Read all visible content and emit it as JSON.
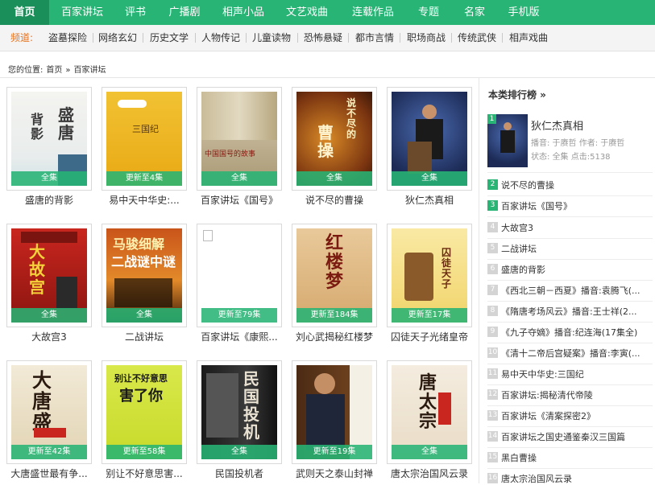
{
  "nav": {
    "items": [
      "首页",
      "百家讲坛",
      "评书",
      "广播剧",
      "相声小品",
      "文艺戏曲",
      "连载作品",
      "专题",
      "名家",
      "手机版"
    ],
    "active": 0
  },
  "channels": {
    "label": "频道:",
    "items": [
      "盗墓探险",
      "网络玄幻",
      "历史文学",
      "人物传记",
      "儿童读物",
      "恐怖悬疑",
      "都市言情",
      "职场商战",
      "传统武侠",
      "相声戏曲"
    ]
  },
  "breadcrumb": {
    "label": "您的位置:",
    "home": "首页",
    "sep": "»",
    "current": "百家讲坛"
  },
  "colors": {
    "accent": "#27b474",
    "channel_label": "#e6731f"
  },
  "books": [
    {
      "title": "盛唐的背影",
      "status": "全集",
      "cover": "c0",
      "cover_text": "盛唐 背影"
    },
    {
      "title": "易中天中华史:...",
      "status": "更新至4集",
      "cover": "c1",
      "cover_text": "三国纪"
    },
    {
      "title": "百家讲坛《国号》",
      "status": "全集",
      "cover": "c2",
      "cover_text": "中国国号的故事"
    },
    {
      "title": "说不尽的曹操",
      "status": "全集",
      "cover": "c3",
      "cover_text": "曹操"
    },
    {
      "title": "狄仁杰真相",
      "status": "全集",
      "cover": "c4",
      "cover_text": ""
    },
    {
      "title": "大故宫3",
      "status": "全集",
      "cover": "c5",
      "cover_text": "大故宫"
    },
    {
      "title": "二战讲坛",
      "status": "全集",
      "cover": "c6",
      "cover_text": "马骏细解 二战谜中谜"
    },
    {
      "title": "百家讲坛《康熙...",
      "status": "更新至79集",
      "cover": "c7",
      "cover_text": ""
    },
    {
      "title": "刘心武揭秘红楼梦",
      "status": "更新至184集",
      "cover": "c8",
      "cover_text": "红楼梦"
    },
    {
      "title": "囚徒天子光绪皇帝",
      "status": "更新至17集",
      "cover": "c9",
      "cover_text": "囚徒天子"
    },
    {
      "title": "大唐盛世最有争...",
      "status": "更新至42集",
      "cover": "c10",
      "cover_text": "大唐盛"
    },
    {
      "title": "别让不好意思害...",
      "status": "更新至58集",
      "cover": "c11",
      "cover_text": "别让不好意思 害了你"
    },
    {
      "title": "民国投机者",
      "status": "全集",
      "cover": "c12",
      "cover_text": "民国投机"
    },
    {
      "title": "武则天之泰山封禅",
      "status": "更新至19集",
      "cover": "c13",
      "cover_text": ""
    },
    {
      "title": "唐太宗治国风云录",
      "status": "全集",
      "cover": "c14",
      "cover_text": "唐太宗"
    }
  ],
  "ranking": {
    "title": "本类排行榜 »",
    "featured": {
      "num": "1",
      "title": "狄仁杰真相",
      "meta1": "播音: 于赓哲 作者: 于赓哲",
      "meta2": "状态: 全集 点击:5138"
    },
    "items": [
      {
        "num": "2",
        "text": "说不尽的曹操"
      },
      {
        "num": "3",
        "text": "百家讲坛《国号》"
      },
      {
        "num": "4",
        "text": "大故宫3"
      },
      {
        "num": "5",
        "text": "二战讲坛"
      },
      {
        "num": "6",
        "text": "盛唐的背影"
      },
      {
        "num": "7",
        "text": "《西北三朝－西夏》播音:袁腾飞(..."
      },
      {
        "num": "8",
        "text": "《隋唐考场风云》播音:王士祥(2..."
      },
      {
        "num": "9",
        "text": "《九子夺嫡》播音:纪连海(17集全)"
      },
      {
        "num": "10",
        "text": "《清十二帝后宫疑案》播音:李寅(..."
      },
      {
        "num": "11",
        "text": "易中天中华史:三国纪"
      },
      {
        "num": "12",
        "text": "百家讲坛:揭秘清代帝陵"
      },
      {
        "num": "13",
        "text": "百家讲坛《清案探密2》"
      },
      {
        "num": "14",
        "text": "百家讲坛之国史通鉴秦汉三国篇"
      },
      {
        "num": "15",
        "text": "黑白曹操"
      },
      {
        "num": "16",
        "text": "唐太宗治国风云录"
      }
    ]
  }
}
